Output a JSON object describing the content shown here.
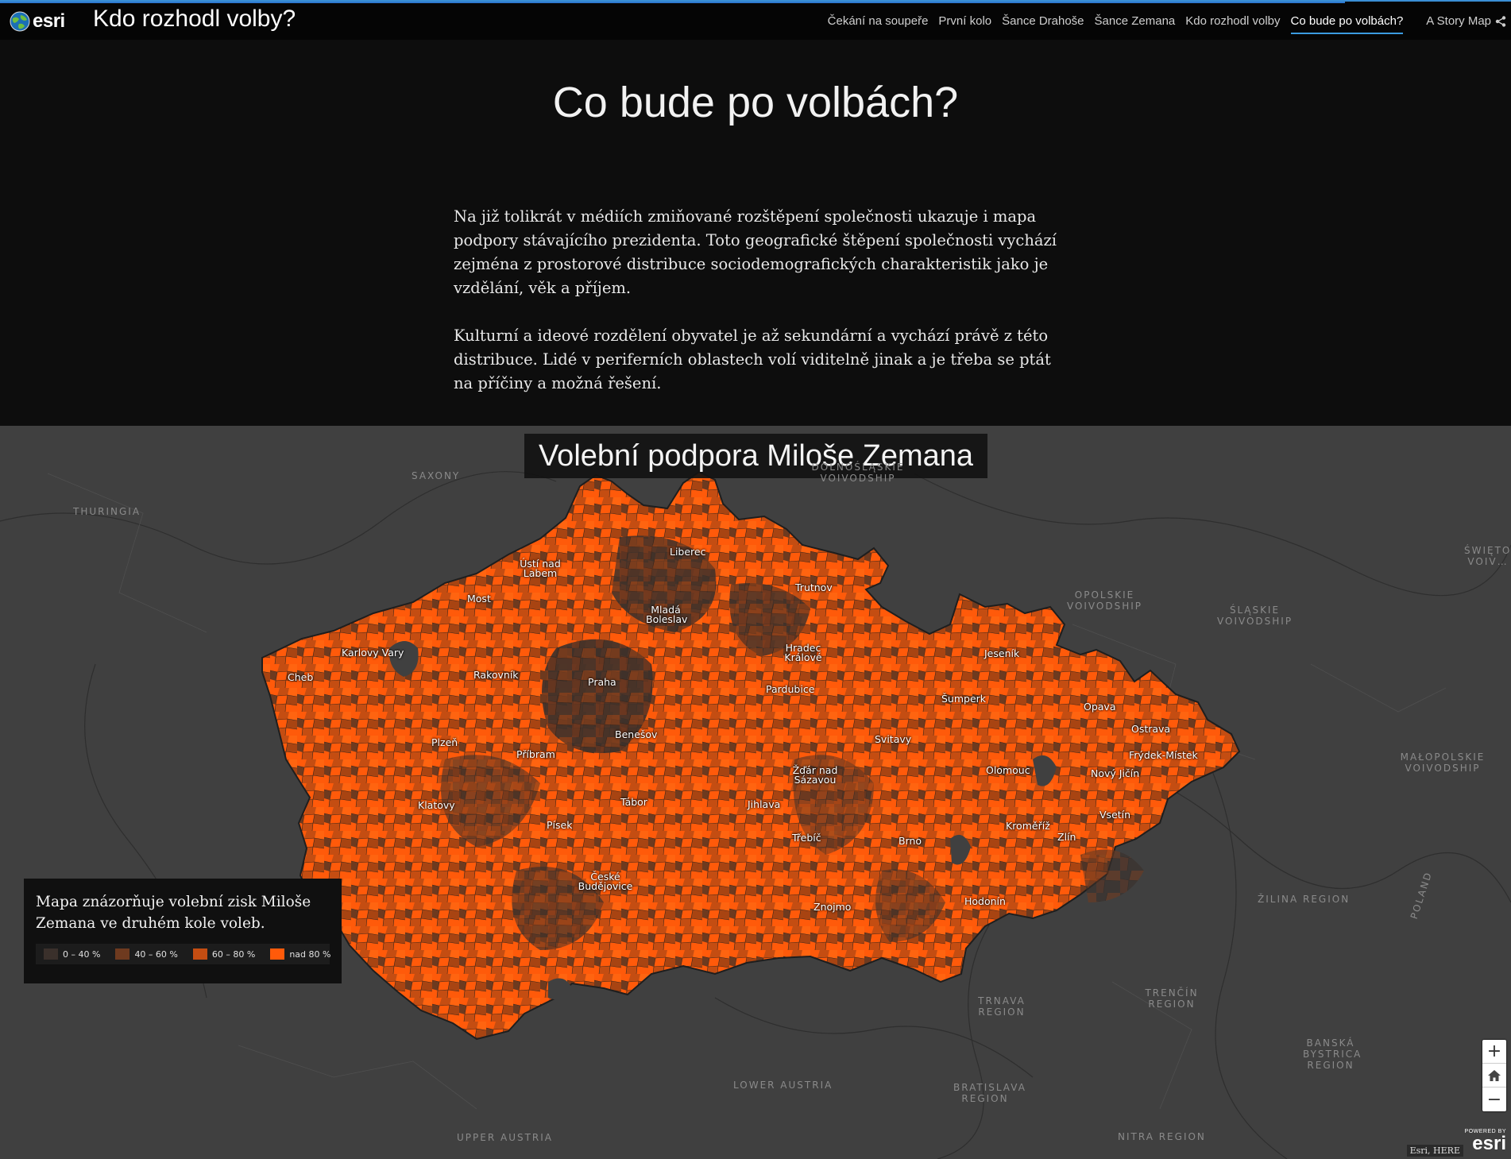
{
  "header": {
    "logo_text": "esri",
    "app_title": "Kdo rozhodl volby?",
    "nav": [
      "Čekání na soupeře",
      "První kolo",
      "Šance Drahoše",
      "Šance Zemana",
      "Kdo rozhodl volby",
      "Co bude po volbách?"
    ],
    "active_nav": "Co bude po volbách?",
    "story_map_link": "A Story Map",
    "accent_color": "#3a9be0"
  },
  "section": {
    "title": "Co bude po volbách?",
    "paragraphs": [
      "Na již tolikrát v médiích zmiňované rozštěpení společnosti ukazuje i mapa podpory stávajícího prezidenta. Toto geografické štěpení společnosti vychází zejména z prostorové distribuce sociodemografických charakteristik jako je vzdělání, věk a příjem.",
      "Kulturní a ideové rozdělení obyvatel je až sekundární a vychází právě z této distribuce. Lidé v periferních oblastech volí viditelně jinak a je třeba se ptát na příčiny a možná řešení."
    ]
  },
  "map": {
    "title": "Volební podpora Miloše Zemana",
    "regions": [
      "SAXONY",
      "THURINGIA",
      "DOLNOŚLĄSKIE VOIVODSHIP",
      "OPOLSKIE VOIVODSHIP",
      "ŚLĄSKIE VOIVODSHIP",
      "ŚWIĘTO… VOIV…",
      "MAŁOPOLSKIE VOIVODSHIP",
      "ŽILINA REGION",
      "TRENČÍN REGION",
      "TRNAVA REGION",
      "BANSKÁ BYSTRICA REGION",
      "BRATISLAVA REGION",
      "NITRA REGION",
      "LOWER AUSTRIA",
      "UPPER AUSTRIA",
      "POLAND"
    ],
    "cities": [
      "Liberec",
      "Ústí nad Labem",
      "Most",
      "Trutnov",
      "Mladá Boleslav",
      "Karlovy Vary",
      "Cheb",
      "Rakovník",
      "Praha",
      "Hradec Králové",
      "Pardubice",
      "Jeseník",
      "Šumperk",
      "Opava",
      "Ostrava",
      "Frýdek-Místek",
      "Benešov",
      "Plzeň",
      "Příbram",
      "Svitavy",
      "Olomouc",
      "Nový Jičín",
      "Žďár nad Sázavou",
      "Klatovy",
      "Tábor",
      "Jihlava",
      "Vsetín",
      "Písek",
      "Kroměříž",
      "Zlín",
      "Třebíč",
      "Brno",
      "České Budějovice",
      "Znojmo",
      "Hodonín"
    ],
    "legend": {
      "text": "Mapa znázorňuje volební zisk Miloše Zemana ve druhém kole voleb.",
      "classes": [
        {
          "label": "0 – 40 %",
          "color": "#3a302b"
        },
        {
          "label": "40 – 60 %",
          "color": "#6e3a1f"
        },
        {
          "label": "60 – 80 %",
          "color": "#c44d12"
        },
        {
          "label": "nad 80 %",
          "color": "#ff5a0a"
        }
      ]
    },
    "zoom": {
      "in": "+",
      "home": "home-icon",
      "out": "−"
    },
    "attribution": "Esri, HERE",
    "powered_by": "POWERED BY",
    "powered_logo": "esri"
  }
}
